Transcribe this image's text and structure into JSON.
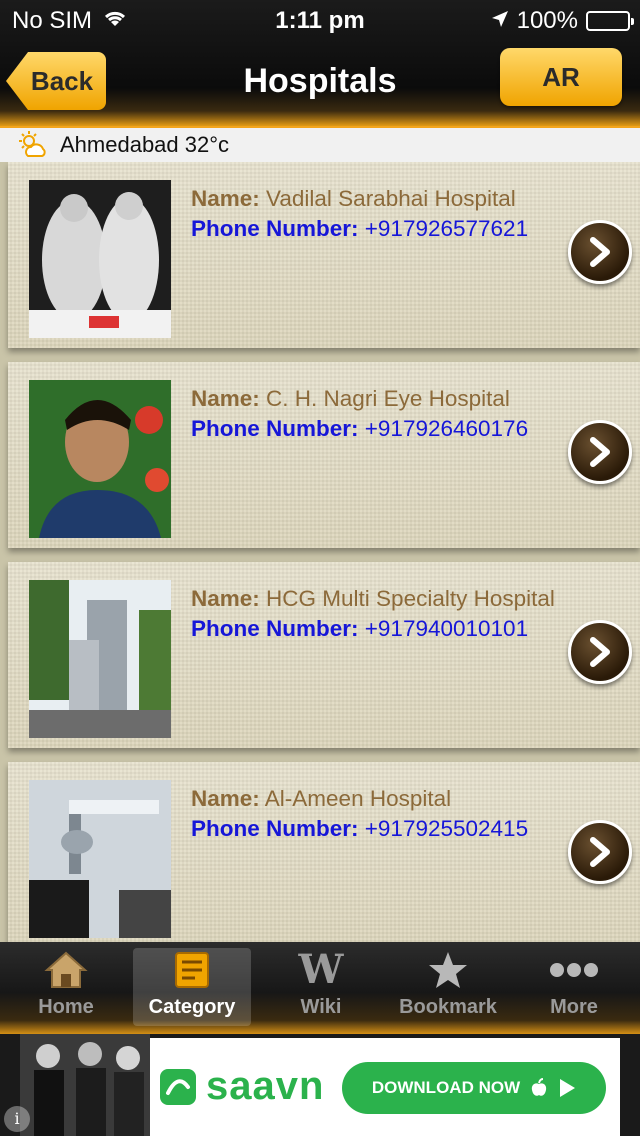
{
  "status_bar": {
    "carrier": "No SIM",
    "time": "1:11 pm",
    "battery": "100%"
  },
  "nav": {
    "back_label": "Back",
    "title": "Hospitals",
    "ar_label": "AR"
  },
  "weather": {
    "text": "Ahmedabad 32°c",
    "icon": "partly-sunny-icon"
  },
  "labels": {
    "name": "Name:",
    "phone": "Phone Number:"
  },
  "hospitals": [
    {
      "name": "Vadilal Sarabhai Hospital",
      "phone": "+917926577621"
    },
    {
      "name": "C. H. Nagri Eye Hospital",
      "phone": "+917926460176"
    },
    {
      "name": "HCG Multi Specialty Hospital",
      "phone": "+917940010101"
    },
    {
      "name": "Al-Ameen Hospital",
      "phone": "+917925502415"
    }
  ],
  "tabs": [
    {
      "label": "Home",
      "icon": "home-icon",
      "active": false
    },
    {
      "label": "Category",
      "icon": "category-icon",
      "active": true
    },
    {
      "label": "Wiki",
      "icon": "wiki-icon",
      "active": false
    },
    {
      "label": "Bookmark",
      "icon": "star-icon",
      "active": false
    },
    {
      "label": "More",
      "icon": "more-icon",
      "active": false
    }
  ],
  "ad": {
    "brand": "saavn",
    "cta": "DOWNLOAD NOW"
  },
  "colors": {
    "accent": "#f0a400",
    "name_text": "#8c6a3a",
    "phone_text": "#1616d8",
    "ad_green": "#2bb24c"
  }
}
